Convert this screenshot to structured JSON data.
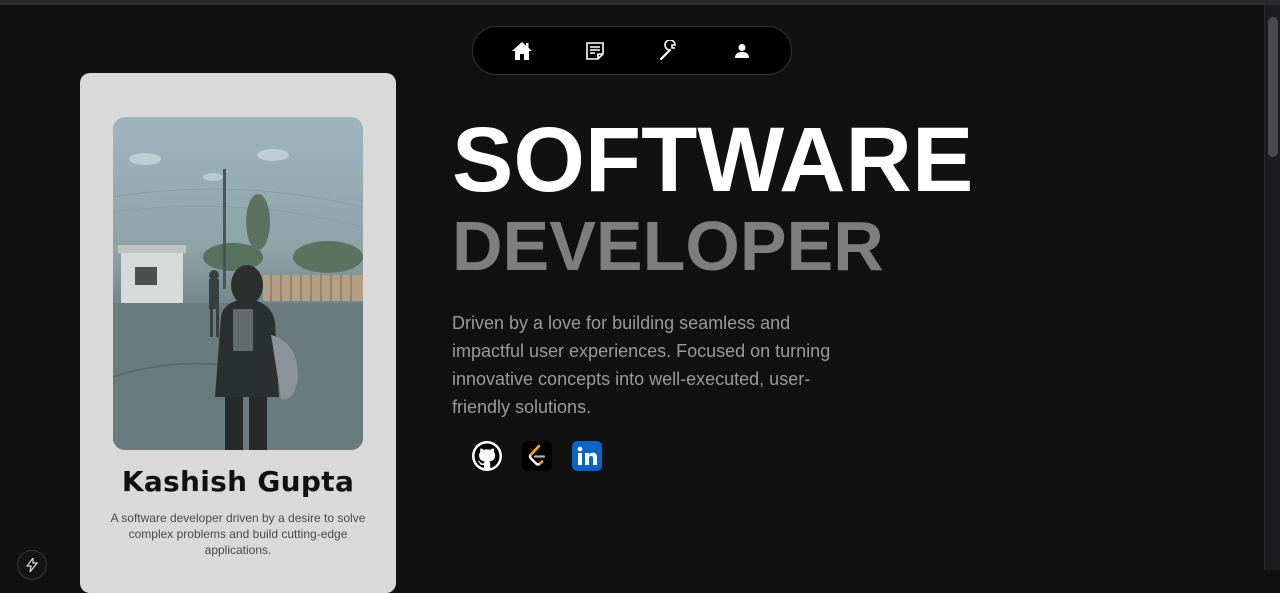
{
  "navbar": {
    "items": [
      {
        "icon": "home-icon"
      },
      {
        "icon": "blog-icon"
      },
      {
        "icon": "tools-icon"
      },
      {
        "icon": "user-icon"
      }
    ]
  },
  "profile": {
    "name": "Kashish Gupta",
    "description": "A software developer driven by a desire to solve complex problems and build cutting-edge applications."
  },
  "hero": {
    "title": "SOFTWARE",
    "subtitle": "DEVELOPER",
    "description": "Driven by a love for building seamless and impactful user experiences. Focused on turning innovative concepts into well-executed, user-friendly solutions."
  },
  "socials": [
    {
      "icon": "github-icon",
      "color": "#ffffff"
    },
    {
      "icon": "leetcode-icon",
      "color": "#000000"
    },
    {
      "icon": "linkedin-icon",
      "color": "#0a66c2"
    }
  ],
  "colors": {
    "background": "#111112",
    "card": "#d9d9d9",
    "title": "#ffffff",
    "subtitle": "#7e7e7e"
  }
}
